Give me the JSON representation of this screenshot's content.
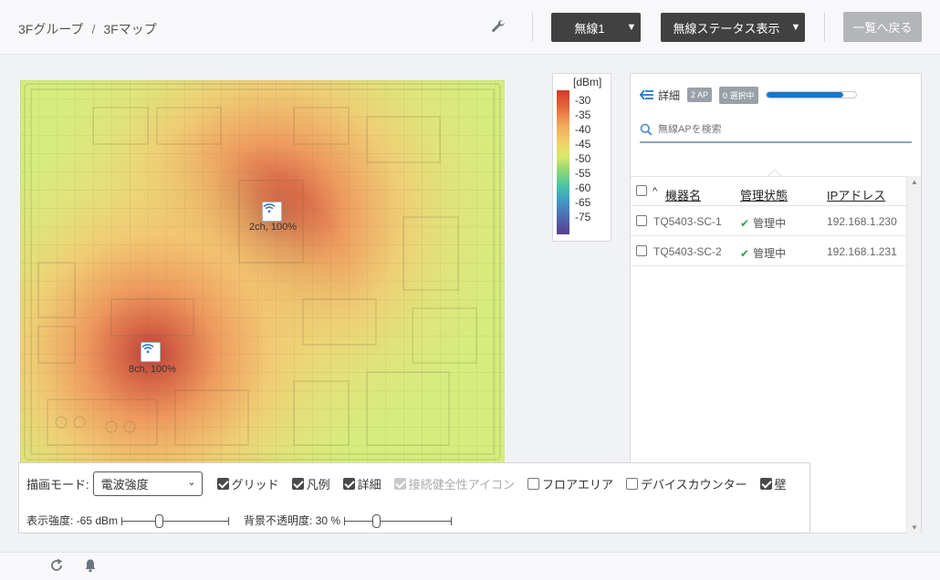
{
  "breadcrumb": {
    "group": "3Fグループ",
    "separator": "/",
    "map": "3Fマップ"
  },
  "header": {
    "radio_dropdown": "無線1",
    "status_dropdown": "無線ステータス表示",
    "back_button": "一覧へ戻る"
  },
  "map": {
    "access_points": [
      {
        "label": "2ch, 100%"
      },
      {
        "label": "8ch, 100%"
      }
    ]
  },
  "legend": {
    "unit": "[dBm]",
    "ticks": [
      "-30",
      "-35",
      "-40",
      "-45",
      "-50",
      "-55",
      "-60",
      "-65",
      "-75"
    ]
  },
  "panel": {
    "detail_label": "詳細",
    "ap_badge": "2 AP",
    "selected_badge": "0 選択中",
    "progress": 0.86,
    "search_placeholder": "無線APを検索",
    "columns": {
      "sort_indicator": "^",
      "device_name": "機器名",
      "mgmt_status": "管理状態",
      "ip_address": "IPアドレス"
    },
    "rows": [
      {
        "name": "TQ5403-SC-1",
        "status": "管理中",
        "ip": "192.168.1.230"
      },
      {
        "name": "TQ5403-SC-2",
        "status": "管理中",
        "ip": "192.168.1.231"
      }
    ]
  },
  "toolbar": {
    "draw_mode_label": "描画モード:",
    "draw_mode_value": "電波強度",
    "options": {
      "grid": "グリッド",
      "legend": "凡例",
      "detail": "詳細",
      "health_icon": "接続健全性アイコン",
      "floor_area": "フロアエリア",
      "device_counter": "デバイスカウンター",
      "wall": "壁"
    },
    "strength_label": "表示強度: -65 dBm",
    "strength_value": -65,
    "opacity_label": "背景不透明度: 30 %",
    "opacity_value": 30
  },
  "colors": {
    "accent": "#1877c9",
    "dark_button": "#414141",
    "ok_green": "#2fa24a"
  }
}
